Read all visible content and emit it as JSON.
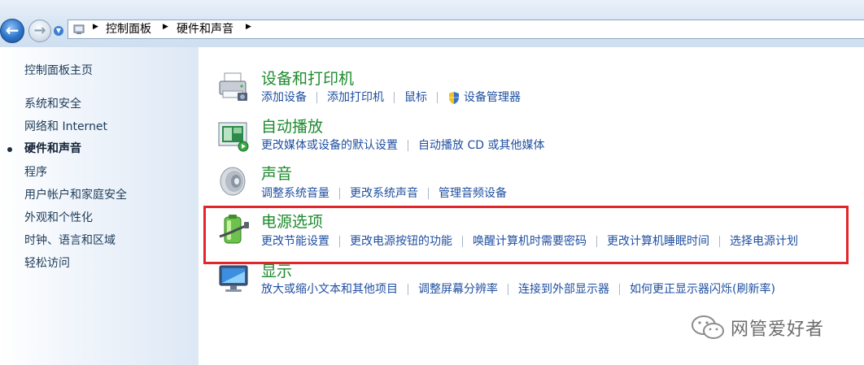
{
  "breadcrumb": {
    "items": [
      "控制面板",
      "硬件和声音"
    ]
  },
  "sidebar": {
    "home": "控制面板主页",
    "items": [
      {
        "label": "系统和安全",
        "current": false
      },
      {
        "label": "网络和 Internet",
        "current": false
      },
      {
        "label": "硬件和声音",
        "current": true
      },
      {
        "label": "程序",
        "current": false
      },
      {
        "label": "用户帐户和家庭安全",
        "current": false
      },
      {
        "label": "外观和个性化",
        "current": false
      },
      {
        "label": "时钟、语言和区域",
        "current": false
      },
      {
        "label": "轻松访问",
        "current": false
      }
    ]
  },
  "categories": [
    {
      "title": "设备和打印机",
      "icon": "printer-icon",
      "links": [
        "添加设备",
        "添加打印机",
        "鼠标",
        "设备管理器"
      ]
    },
    {
      "title": "自动播放",
      "icon": "autoplay-icon",
      "links": [
        "更改媒体或设备的默认设置",
        "自动播放 CD 或其他媒体"
      ]
    },
    {
      "title": "声音",
      "icon": "speaker-icon",
      "links": [
        "调整系统音量",
        "更改系统声音",
        "管理音频设备"
      ]
    },
    {
      "title": "电源选项",
      "icon": "battery-icon",
      "links": [
        "更改节能设置",
        "更改电源按钮的功能",
        "唤醒计算机时需要密码",
        "更改计算机睡眠时间",
        "选择电源计划"
      ]
    },
    {
      "title": "显示",
      "icon": "display-icon",
      "links": [
        "放大或缩小文本和其他项目",
        "调整屏幕分辨率",
        "连接到外部显示器",
        "如何更正显示器闪烁(刷新率)"
      ]
    }
  ],
  "watermark": {
    "text": "网管爱好者"
  },
  "colors": {
    "title_green": "#1e8a2e",
    "link_blue": "#1f4fa0",
    "highlight_red": "#e3262b"
  }
}
